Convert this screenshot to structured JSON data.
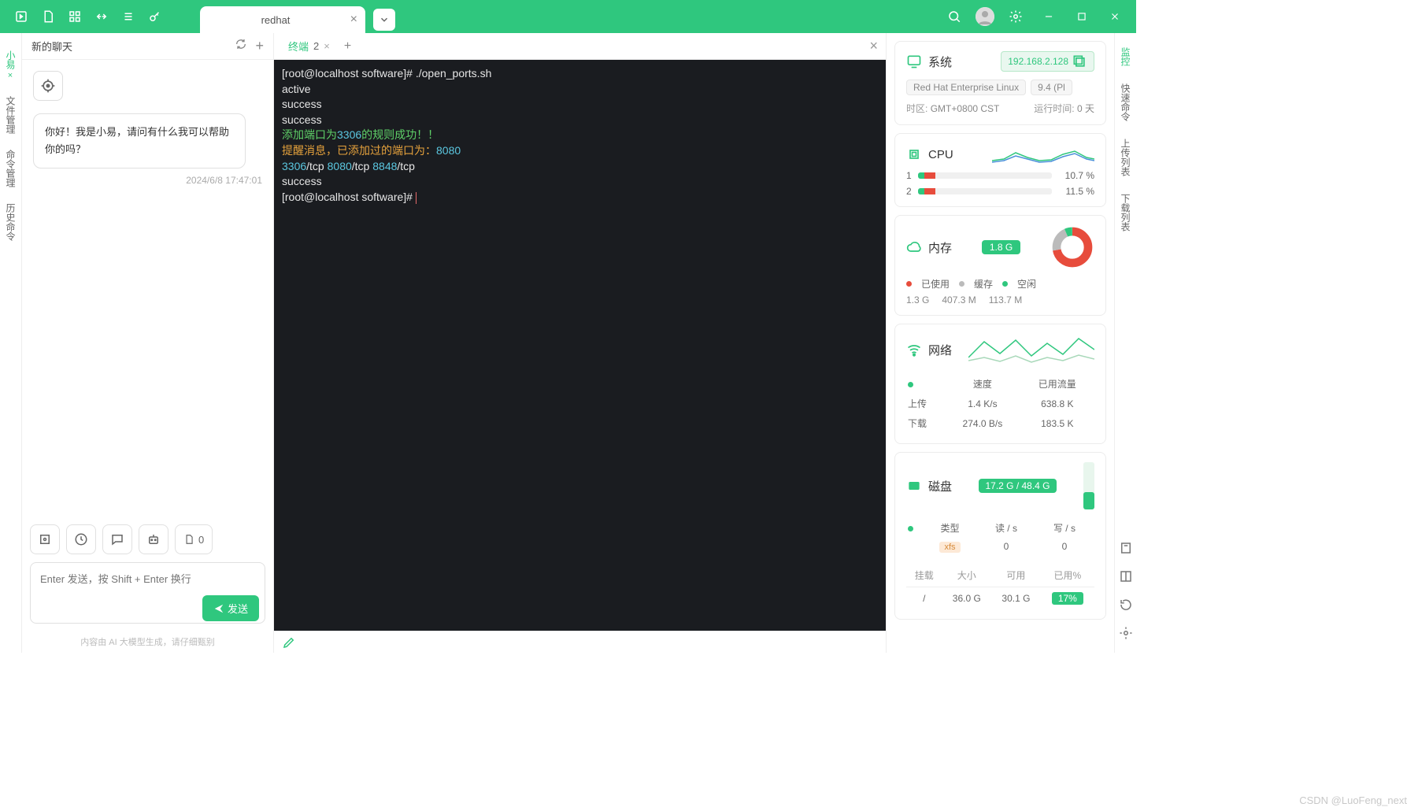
{
  "titlebar": {
    "tab_title": "redhat",
    "dropdown_glyph": "⌄"
  },
  "left_tabs": [
    "小易",
    "文件管理",
    "命令管理",
    "历史命令"
  ],
  "chat": {
    "header": "新的聊天",
    "bubble": "你好！我是小易，请问有什么我可以帮助你的吗？",
    "timestamp": "2024/6/8 17:47:01",
    "file_count": "0",
    "input_placeholder": "Enter 发送，按 Shift + Enter 换行",
    "send_label": "发送",
    "disclaimer": "内容由 AI 大模型生成，请仔细甄别"
  },
  "terminal": {
    "tab_label": "终端",
    "tab_num": "2",
    "lines": [
      {
        "segs": [
          {
            "t": "[root@localhost software]# ./open_ports.sh"
          }
        ]
      },
      {
        "segs": [
          {
            "t": "active"
          }
        ]
      },
      {
        "segs": [
          {
            "t": "success"
          }
        ]
      },
      {
        "segs": [
          {
            "t": "success"
          }
        ]
      },
      {
        "segs": [
          {
            "t": "添加端口为",
            "c": "t-green"
          },
          {
            "t": "3306",
            "c": "t-cyan"
          },
          {
            "t": "的规则成功！！",
            "c": "t-green"
          }
        ]
      },
      {
        "segs": [
          {
            "t": "提醒消息，已添加过的端口为：",
            "c": "t-orange"
          },
          {
            "t": "8080",
            "c": "t-cyan"
          }
        ]
      },
      {
        "segs": [
          {
            "t": "3306",
            "c": "t-cyan"
          },
          {
            "t": "/tcp "
          },
          {
            "t": "8080",
            "c": "t-cyan"
          },
          {
            "t": "/tcp "
          },
          {
            "t": "8848",
            "c": "t-cyan"
          },
          {
            "t": "/tcp"
          }
        ]
      },
      {
        "segs": [
          {
            "t": "success"
          }
        ]
      },
      {
        "segs": [
          {
            "t": "[root@localhost software]# "
          },
          {
            "t": "",
            "cursor": true
          }
        ]
      }
    ]
  },
  "monitor": {
    "system": {
      "title": "系统",
      "ip": "192.168.2.128",
      "os": "Red Hat Enterprise Linux",
      "version": "9.4 (Pl",
      "tz_label": "时区:",
      "tz_value": "GMT+0800 CST",
      "uptime_label": "运行时间:",
      "uptime_value": "0 天"
    },
    "cpu": {
      "title": "CPU",
      "cores": [
        {
          "id": "1",
          "pct": "10.7 %"
        },
        {
          "id": "2",
          "pct": "11.5 %"
        }
      ]
    },
    "memory": {
      "title": "内存",
      "total": "1.8 G",
      "legend": {
        "used": "已使用",
        "cache": "缓存",
        "free": "空闲"
      },
      "used": "1.3 G",
      "cache": "407.3 M",
      "free": "113.7 M"
    },
    "network": {
      "title": "网络",
      "cols": [
        "",
        "速度",
        "已用流量"
      ],
      "rows": [
        {
          "label": "上传",
          "speed": "1.4 K/s",
          "total": "638.8 K"
        },
        {
          "label": "下载",
          "speed": "274.0 B/s",
          "total": "183.5 K"
        }
      ]
    },
    "disk": {
      "title": "磁盘",
      "summary": "17.2 G / 48.4 G",
      "stat_cols": [
        "类型",
        "读 / s",
        "写 / s"
      ],
      "stat_row": {
        "type": "xfs",
        "read": "0",
        "write": "0"
      },
      "table_cols": [
        "挂载",
        "大小",
        "可用",
        "已用%"
      ],
      "table_row": {
        "mount": "/",
        "size": "36.0 G",
        "avail": "30.1 G",
        "used_pct": "17%"
      }
    }
  },
  "right_tabs": [
    "监控",
    "快速命令",
    "上传列表",
    "下载列表"
  ],
  "watermark": "CSDN @LuoFeng_next"
}
